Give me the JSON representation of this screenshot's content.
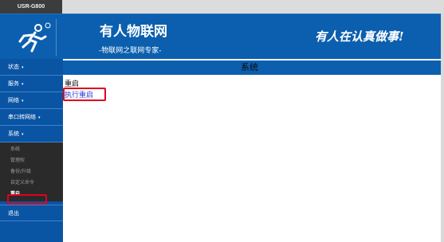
{
  "device": "USR-G800",
  "header": {
    "title": "有人物联网",
    "subtitle": "-物联网之联网专家-",
    "slogan": "有人在认真做事!"
  },
  "sidebar": {
    "items": [
      {
        "label": "状态",
        "caret": "▾"
      },
      {
        "label": "服务",
        "caret": "▾"
      },
      {
        "label": "网络",
        "caret": "▾"
      },
      {
        "label": "串口转网络",
        "caret": "▾"
      },
      {
        "label": "系统",
        "caret": "▾"
      }
    ],
    "submenu": [
      "系统",
      "管理权",
      "备份/升级",
      "自定义命令",
      "重启"
    ],
    "logout": "退出"
  },
  "main": {
    "heading": "系统",
    "section_title": "重启",
    "reboot_link": "执行重启"
  },
  "colors": {
    "primary": "#0b5fae",
    "highlight": "#e0001e",
    "link": "#2d3fd1"
  }
}
